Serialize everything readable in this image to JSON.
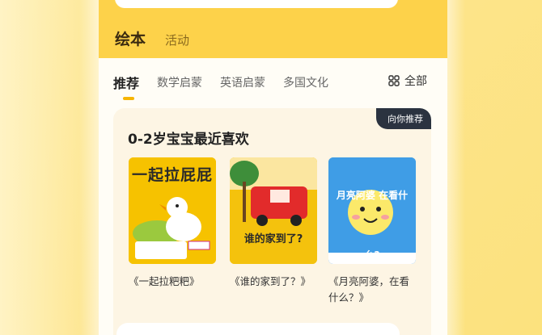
{
  "header": {
    "tabs": [
      {
        "label": "绘本",
        "active": true
      },
      {
        "label": "活动",
        "active": false
      }
    ]
  },
  "categories": {
    "items": [
      {
        "label": "推荐",
        "active": true
      },
      {
        "label": "数学启蒙",
        "active": false
      },
      {
        "label": "英语启蒙",
        "active": false
      },
      {
        "label": "多国文化",
        "active": false
      }
    ],
    "all_label": "全部"
  },
  "recommend_card": {
    "badge": "向你推荐",
    "title": "0-2岁宝宝最近喜欢",
    "books": [
      {
        "title": "《一起拉粑粑》",
        "cover_text": "一起拉屁屁",
        "cover_color": "#f6c200"
      },
      {
        "title": "《谁的家到了？》",
        "cover_text": "谁的家到了?",
        "cover_color": "#f4c20d"
      },
      {
        "title": "《月亮阿婆，在看什么？》",
        "cover_text": "月亮阿婆 在看什么?",
        "cover_color": "#3f9de6"
      }
    ]
  },
  "colors": {
    "accent": "#fdd24a",
    "indicator": "#f7b500",
    "badge_bg": "#2b3340"
  }
}
